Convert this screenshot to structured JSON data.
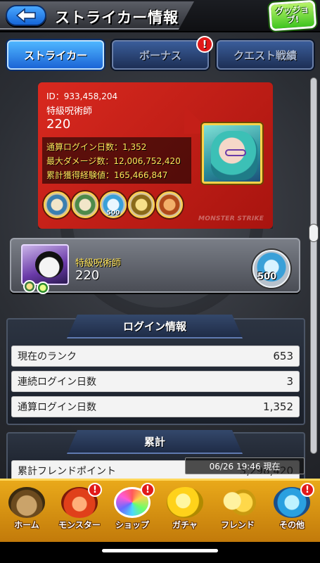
{
  "header": {
    "title": "ストライカー情報",
    "back_icon": "back-arrow-icon",
    "good_job_label": "グッジョブ!"
  },
  "tabs": [
    {
      "label": "ストライカー",
      "active": true
    },
    {
      "label": "ボーナス",
      "active": false,
      "badge": "!"
    },
    {
      "label": "クエスト戦績",
      "active": false
    }
  ],
  "profile": {
    "id_text": "ID：933,458,204",
    "name": "特級呪術師",
    "rank": "220",
    "stats": [
      "通算ログイン日数：1,352",
      "最大ダメージ数：12,006,752,420",
      "累計獲得経験値：165,466,847"
    ],
    "badge_500": "500",
    "footer": "MONSTER STRIKE"
  },
  "striker": {
    "name": "特級呪術師",
    "rank": "220",
    "badge_value": "500"
  },
  "login_info": {
    "title": "ログイン情報",
    "rows": [
      {
        "label": "現在のランク",
        "value": "653"
      },
      {
        "label": "連続ログイン日数",
        "value": "3"
      },
      {
        "label": "通算ログイン日数",
        "value": "1,352"
      }
    ]
  },
  "cumulative": {
    "title": "累計",
    "rows": [
      {
        "label": "累計フレンドポイント",
        "value": "3,298,420"
      }
    ]
  },
  "timestamp": "06/26 19:46 現在",
  "bottom_nav": [
    {
      "label": "ホーム",
      "icon": "home-icon"
    },
    {
      "label": "モンスター",
      "icon": "monster-icon",
      "badge": "!"
    },
    {
      "label": "ショップ",
      "icon": "shop-orb-icon",
      "badge": "!"
    },
    {
      "label": "ガチャ",
      "icon": "gacha-icon"
    },
    {
      "label": "フレンド",
      "icon": "friend-icon"
    },
    {
      "label": "その他",
      "icon": "other-icon",
      "badge": "!"
    }
  ],
  "colors": {
    "accent_blue": "#1b64d6",
    "card_red": "#c41f18",
    "nav_gold": "#e9a91a",
    "alert_red": "#e11a1a"
  }
}
